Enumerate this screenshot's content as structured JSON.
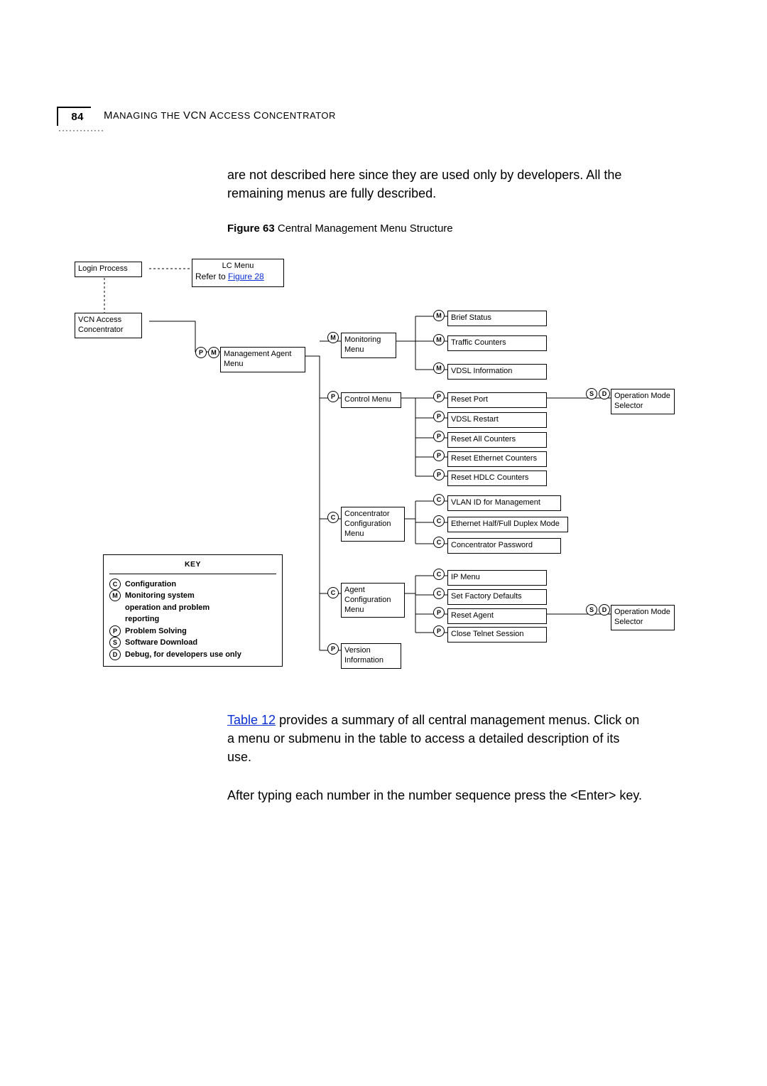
{
  "header": {
    "page_number": "84",
    "title_prefix": "M",
    "title_small": "ANAGING THE ",
    "title_prefix2": "VCN A",
    "title_small2": "CCESS ",
    "title_prefix3": "C",
    "title_small3": "ONCENTRATOR"
  },
  "body": {
    "para1": "are not described here since they are used only by developers. All the remaining menus are fully described.",
    "figcap_bold": "Figure 63",
    "figcap_text": "   Central Management Menu Structure",
    "para2_pre": "Table 12",
    "para2_post": " provides a summary of all central management menus. Click on a menu or submenu in the table to access a detailed description of its use.",
    "para3": "After typing each number in the number sequence press the <Enter> key."
  },
  "diagram": {
    "login": "Login Process",
    "lc_menu": "LC Menu",
    "lc_refer": "Refer to ",
    "lc_link": "Figure 28",
    "vcn": "VCN Access\nConcentrator",
    "mgmt": "Management Agent\nMenu",
    "monitoring": "Monitoring\nMenu",
    "control": "Control Menu",
    "conc_cfg": "Concentrator\nConfiguration\nMenu",
    "agent_cfg": "Agent\nConfiguration\nMenu",
    "version": "Version\nInformation",
    "brief_status": "Brief Status",
    "traffic": "Traffic Counters",
    "vdsl_info": "VDSL Information",
    "reset_port": "Reset Port",
    "vdsl_restart": "VDSL Restart",
    "reset_all": "Reset All Counters",
    "reset_eth": "Reset Ethernet Counters",
    "reset_hdlc": "Reset HDLC Counters",
    "vlan_id": "VLAN ID for Management",
    "eth_duplex": "Ethernet Half/Full Duplex Mode",
    "conc_pwd": "Concentrator Password",
    "ip_menu": "IP Menu",
    "set_fac": "Set Factory Defaults",
    "reset_agent": "Reset Agent",
    "close_telnet": "Close Telnet Session",
    "op_mode": "Operation\nMode Selector",
    "key_title": "KEY",
    "key_c": "Configuration",
    "key_m": "Monitoring system\noperation and problem\nreporting",
    "key_p": "Problem Solving",
    "key_s": "Software Download",
    "key_d": "Debug, for developers use only"
  }
}
